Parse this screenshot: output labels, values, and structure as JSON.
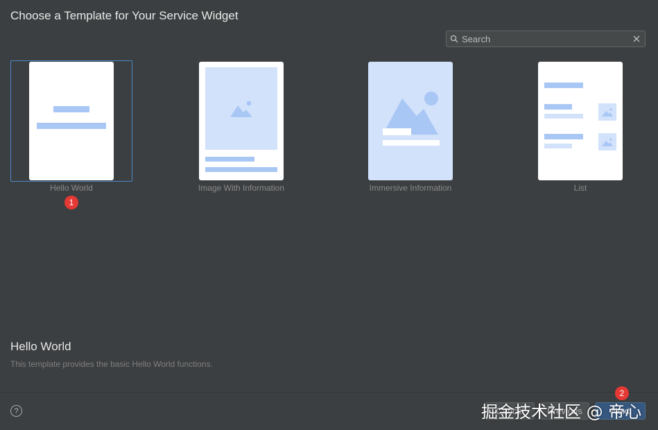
{
  "dialog": {
    "title": "Choose a Template for Your Service Widget"
  },
  "search": {
    "placeholder": "Search",
    "icon": "search-icon",
    "clear_icon": "close-icon"
  },
  "templates": [
    {
      "label": "Hello World",
      "selected": true
    },
    {
      "label": "Image With Information",
      "selected": false
    },
    {
      "label": "Immersive Information",
      "selected": false
    },
    {
      "label": "List",
      "selected": false
    }
  ],
  "description": {
    "title": "Hello World",
    "text": "This template provides the basic Hello World functions."
  },
  "badges": {
    "first": "1",
    "second": "2"
  },
  "footer": {
    "help_glyph": "?",
    "cancel_label": "Cancel",
    "previous_label": "Previous",
    "next_label": "Next"
  },
  "watermark": "掘金技术社区 @ 帝心",
  "colors": {
    "background": "#3c3f41",
    "selection_border": "#4a88c7",
    "thumb_accent": "#a9c7f5",
    "thumb_light": "#d3e2fb",
    "badge": "#e53935",
    "primary_button": "#365880"
  }
}
